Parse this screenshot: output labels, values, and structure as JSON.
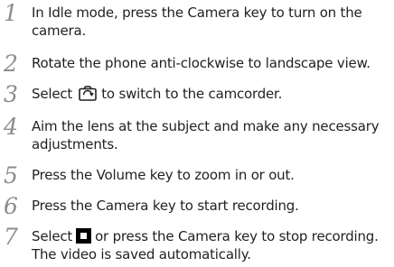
{
  "steps": [
    {
      "number": "1",
      "lines": [
        "In Idle mode, press the Camera key to turn on the",
        "camera."
      ]
    },
    {
      "number": "2",
      "lines": [
        "Rotate the phone anti-clockwise to landscape view."
      ]
    },
    {
      "number": "3",
      "before_icon": "Select",
      "icon": "camcorder-switch-icon",
      "after_icon": "to switch to the camcorder."
    },
    {
      "number": "4",
      "lines": [
        "Aim the lens at the subject and make any necessary",
        "adjustments."
      ]
    },
    {
      "number": "5",
      "lines": [
        "Press the Volume key to zoom in or out."
      ]
    },
    {
      "number": "6",
      "lines": [
        "Press the Camera key to start recording."
      ]
    },
    {
      "number": "7",
      "before_icon": "Select",
      "icon": "stop-icon",
      "after_icon": "or press the Camera key to stop recording.",
      "lines": [
        "The video is saved automatically."
      ]
    }
  ]
}
